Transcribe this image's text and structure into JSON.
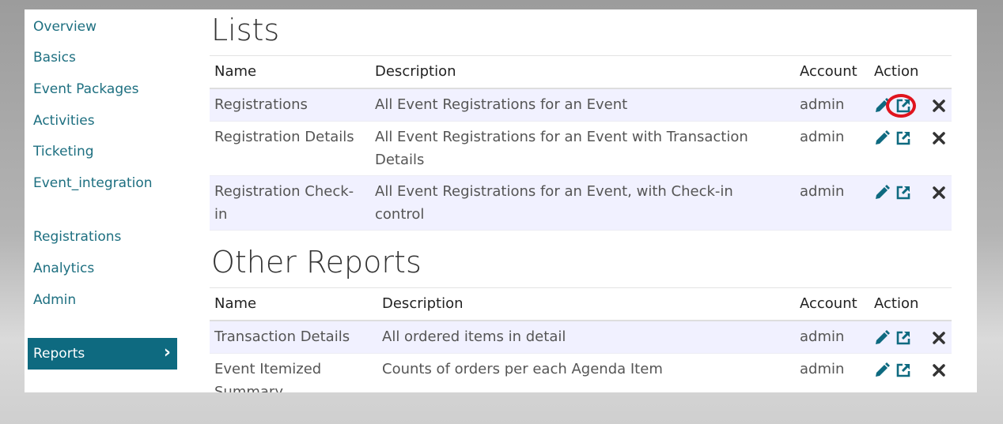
{
  "sidebar": {
    "items": [
      {
        "label": "Overview"
      },
      {
        "label": "Basics"
      },
      {
        "label": "Event Packages"
      },
      {
        "label": "Activities"
      },
      {
        "label": "Ticketing"
      },
      {
        "label": "Event_integration"
      },
      {
        "label": "Registrations"
      },
      {
        "label": "Analytics"
      },
      {
        "label": "Admin"
      }
    ],
    "active_item": {
      "label": "Reports",
      "chevron": "›"
    }
  },
  "lists": {
    "title": "Lists",
    "headers": {
      "name": "Name",
      "description": "Description",
      "account": "Account",
      "action": "Action"
    },
    "rows": [
      {
        "name": "Registrations",
        "description": "All Event Registrations for an Event",
        "account": "admin"
      },
      {
        "name": "Registration Details",
        "description": "All Event Registrations for an Event with Transaction Details",
        "account": "admin"
      },
      {
        "name": "Registration Check-in",
        "description": "All Event Registrations for an Event, with Check-in control",
        "account": "admin"
      }
    ]
  },
  "other_reports": {
    "title": "Other Reports",
    "headers": {
      "name": "Name",
      "description": "Description",
      "account": "Account",
      "action": "Action"
    },
    "rows": [
      {
        "name": "Transaction Details",
        "description": "All ordered items in detail",
        "account": "admin"
      },
      {
        "name": "Event Itemized Summary",
        "description": "Counts of orders per each Agenda Item",
        "account": "admin"
      }
    ]
  },
  "icons": {
    "edit": "pencil-icon",
    "open": "external-link-icon",
    "delete": "close-icon"
  },
  "colors": {
    "accent": "#0e6a80",
    "link": "#1d6f80",
    "row_alt": "#f1f1ff",
    "highlight": "#e0141e"
  }
}
